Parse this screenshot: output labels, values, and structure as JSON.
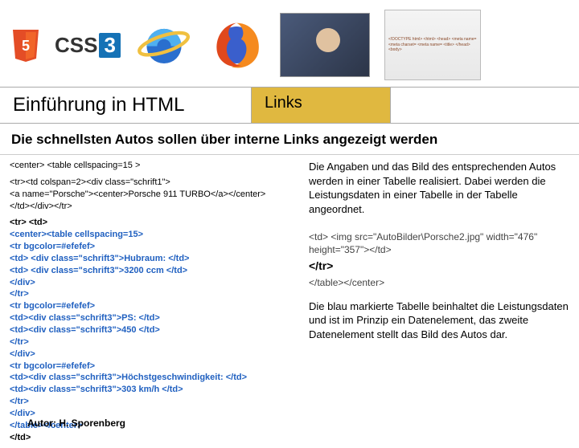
{
  "header": {
    "css3_label": "CSS",
    "css3_num": "3"
  },
  "title": {
    "main": "Einführung in HTML",
    "tab": "Links"
  },
  "subtitle": "Die schnellsten Autos sollen über interne Links angezeigt werden",
  "code_left": {
    "line1": "<center> <table cellspacing=15 >",
    "line2": "<tr><td colspan=2><div class=\"schrift1\">",
    "line3": "<a name=\"Porsche\"><center>Porsche 911 TURBO</a></center>",
    "line4": "</td></div></tr>",
    "b1": "<tr> <td>",
    "b2": "<center><table cellspacing=15>",
    "b3": "<tr bgcolor=#efefef>",
    "b4": "<td> <div class=\"schrift3\">Hubraum: </td>",
    "b5": "<td> <div class=\"schrift3\">3200 ccm </td>",
    "b6": "</div>",
    "b7": "</tr>",
    "b8": "<tr bgcolor=#efefef>",
    "b9": "<td><div class=\"schrift3\">PS: </td>",
    "b10": "<td><div class=\"schrift3\">450 </td>",
    "b11": "</tr>",
    "b12": "</div>",
    "b13": "<tr bgcolor=#efefef>",
    "b14": "<td><div class=\"schrift3\">Höchstgeschwindigkeit: </td>",
    "b15": "<td><div class=\"schrift3\">303 km/h                </td>",
    "b16": "</tr>",
    "b17": "</div>",
    "b18": "</table></center>",
    "b19": "</td>"
  },
  "right": {
    "para1": "Die Angaben und das Bild des entsprechenden Autos werden in einer Tabelle realisiert. Dabei werden die Leistungsdaten in einer Tabelle in der Tabelle angeordnet.",
    "code1": "<td> <img src=\"AutoBilder\\Porsche2.jpg\" width=\"476\" height=\"357\"></td>",
    "code2": "</tr>",
    "code3": "</table></center>",
    "para2": "Die blau markierte Tabelle beinhaltet die Leistungsdaten und ist im Prinzip ein Datenelement, das zweite Datenelement stellt das Bild des Autos dar."
  },
  "author": "Autor: H. Sporenberg",
  "codesheet_lines": "<!DOCTYPE html>\n<html>\n<head>\n<meta name=\n<meta charset=\n<meta name=\n<title>\n</head>\n<body>"
}
